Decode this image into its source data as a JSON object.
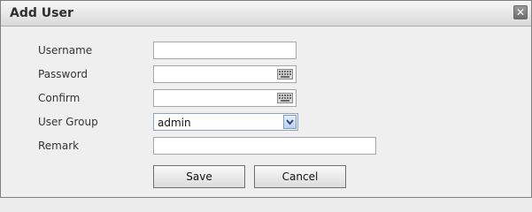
{
  "dialog": {
    "title": "Add User",
    "close_symbol": "✕"
  },
  "form": {
    "username": {
      "label": "Username",
      "value": ""
    },
    "password": {
      "label": "Password",
      "value": "",
      "icon": "keyboard-icon"
    },
    "confirm": {
      "label": "Confirm",
      "value": "",
      "icon": "keyboard-icon"
    },
    "user_group": {
      "label": "User Group",
      "selected": "admin"
    },
    "remark": {
      "label": "Remark",
      "value": ""
    }
  },
  "buttons": {
    "save_label": "Save",
    "cancel_label": "Cancel"
  }
}
